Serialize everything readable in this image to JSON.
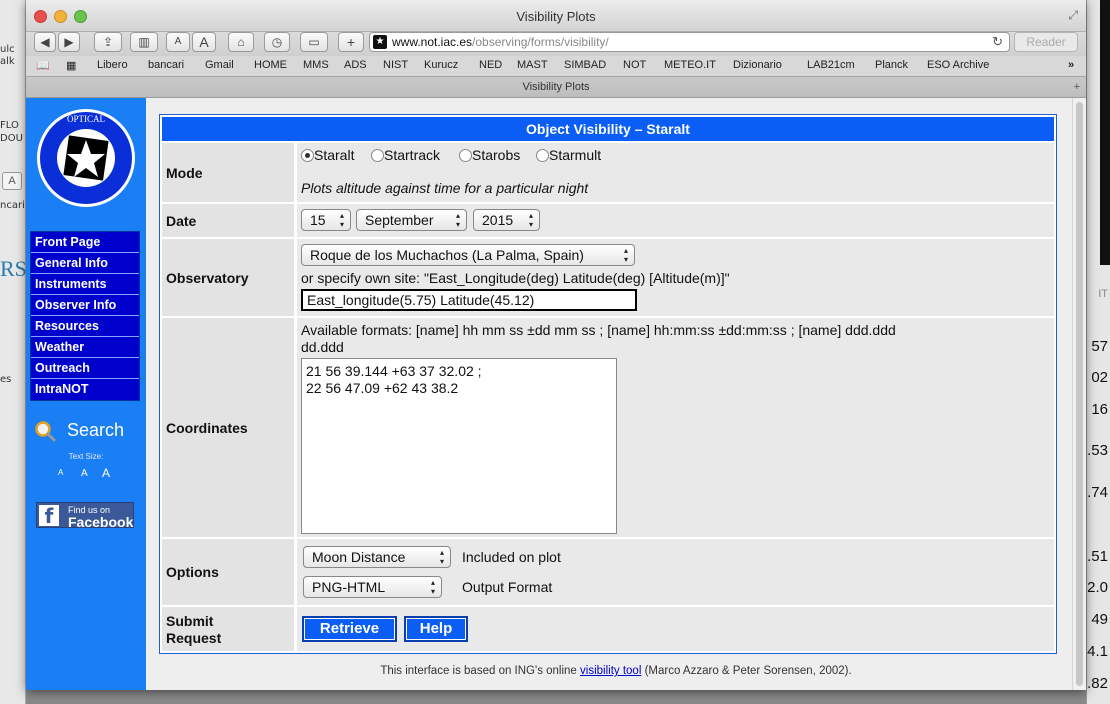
{
  "window": {
    "title": "Visibility Plots",
    "address": {
      "host": "www.not.iac.es",
      "path": "/observing/forms/visibility/"
    },
    "reader_label": "Reader",
    "tab_title": "Visibility Plots",
    "bookmarks": [
      "Libero",
      "bancari",
      "Gmail",
      "HOME",
      "MMS",
      "ADS",
      "NIST",
      "Kurucz",
      "NED",
      "MAST",
      "SIMBAD",
      "NOT",
      "METEO.IT",
      "Dizionario",
      "LAB21cm",
      "Planck",
      "ESO Archive"
    ]
  },
  "sidebar": {
    "nav": [
      "Front Page",
      "General Info",
      "Instruments",
      "Observer Info",
      "Resources",
      "Weather",
      "Outreach",
      "IntraNOT"
    ],
    "search_label": "Search",
    "text_size_label": "Text Size:",
    "text_size_options": [
      "A",
      "A",
      "A"
    ],
    "facebook_line1": "Find us on",
    "facebook_line2": "Facebook"
  },
  "form": {
    "header": "Object Visibility – Staralt",
    "mode": {
      "label": "Mode",
      "options": [
        "Staralt",
        "Startrack",
        "Starobs",
        "Starmult"
      ],
      "selected": "Staralt",
      "hint": "Plots altitude against time for a particular night"
    },
    "date": {
      "label": "Date",
      "day": "15",
      "month": "September",
      "year": "2015"
    },
    "observatory": {
      "label": "Observatory",
      "selected": "Roque de los Muchachos (La Palma, Spain)",
      "own_site_text": "or specify own site: \"East_Longitude(deg) Latitude(deg) [Altitude(m)]\"",
      "own_site_value": "East_longitude(5.75) Latitude(45.12)"
    },
    "coordinates": {
      "label": "Coordinates",
      "formats_line1": "Available formats: [name] hh mm ss ±dd mm ss ; [name] hh:mm:ss ±dd:mm:ss ; [name] ddd.ddd",
      "formats_line2": "dd.ddd",
      "value": "21 56 39.144 +63 37 32.02 ;\n22 56 47.09 +62 43 38.2"
    },
    "options": {
      "label": "Options",
      "moon_select": "Moon Distance",
      "moon_note": "Included on plot",
      "format_select": "PNG-HTML",
      "format_note": "Output Format"
    },
    "submit": {
      "label_line1": "Submit",
      "label_line2": "Request",
      "retrieve": "Retrieve",
      "help": "Help"
    }
  },
  "footer": {
    "before": "This interface is based on ING's online ",
    "link": "visibility tool",
    "after": " (Marco Azzaro & Peter Sorensen, 2002)."
  },
  "background": {
    "left_fragments": [
      "ulc",
      "alk",
      "FLO",
      "DOU",
      "A",
      "ncari",
      "RSI",
      "es"
    ],
    "right_fragments": [
      "IT",
      "57",
      "02",
      "16",
      ".53",
      ".74",
      ".51",
      "2.0",
      "49",
      "4.1",
      ".82"
    ]
  }
}
